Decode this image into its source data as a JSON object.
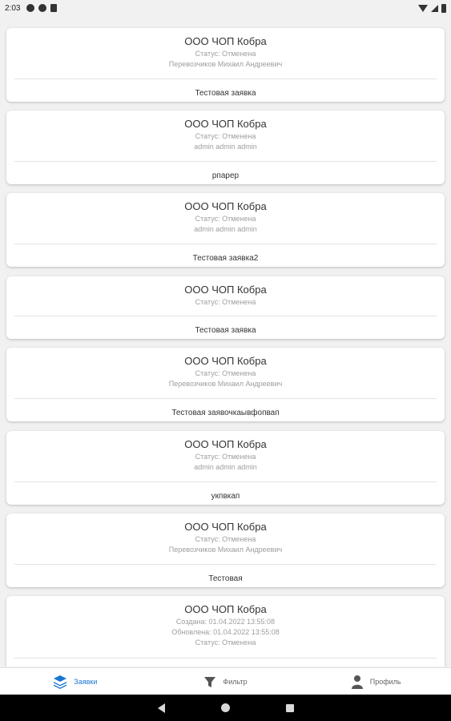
{
  "status_bar": {
    "time": "2:03"
  },
  "cards": [
    {
      "title": "ООО ЧОП Кобра",
      "lines": [
        "Статус: Отменена",
        "Перевозчиков Михаил Андреевич"
      ],
      "name": "Тестовая заявка"
    },
    {
      "title": "ООО ЧОП Кобра",
      "lines": [
        "Статус: Отменена",
        "admin admin admin"
      ],
      "name": "рпарер"
    },
    {
      "title": "ООО ЧОП Кобра",
      "lines": [
        "Статус: Отменена",
        "admin admin admin"
      ],
      "name": "Тестовая заявка2"
    },
    {
      "title": "ООО ЧОП Кобра",
      "lines": [
        "Статус: Отменена"
      ],
      "name": "Тестовая заявка"
    },
    {
      "title": "ООО ЧОП Кобра",
      "lines": [
        "Статус: Отменена",
        "Перевозчиков Михаил Андреевич"
      ],
      "name": "Тестовая заявочкаывфопвап"
    },
    {
      "title": "ООО ЧОП Кобра",
      "lines": [
        "Статус: Отменена",
        "admin admin admin"
      ],
      "name": "укпвкап"
    },
    {
      "title": "ООО ЧОП Кобра",
      "lines": [
        "Статус: Отменена",
        "Перевозчиков Михаил Андреевич"
      ],
      "name": "Тестовая"
    },
    {
      "title": "ООО ЧОП Кобра",
      "lines": [
        "Создана: 01.04.2022 13:55:08",
        "Обновлена: 01.04.2022 13:55:08",
        "Статус: Отменена"
      ],
      "name": ""
    }
  ],
  "bottom_nav": {
    "requests_label": "Заявки",
    "filter_label": "Фильтр",
    "profile_label": "Профиль"
  },
  "colors": {
    "accent": "#1976d2"
  }
}
